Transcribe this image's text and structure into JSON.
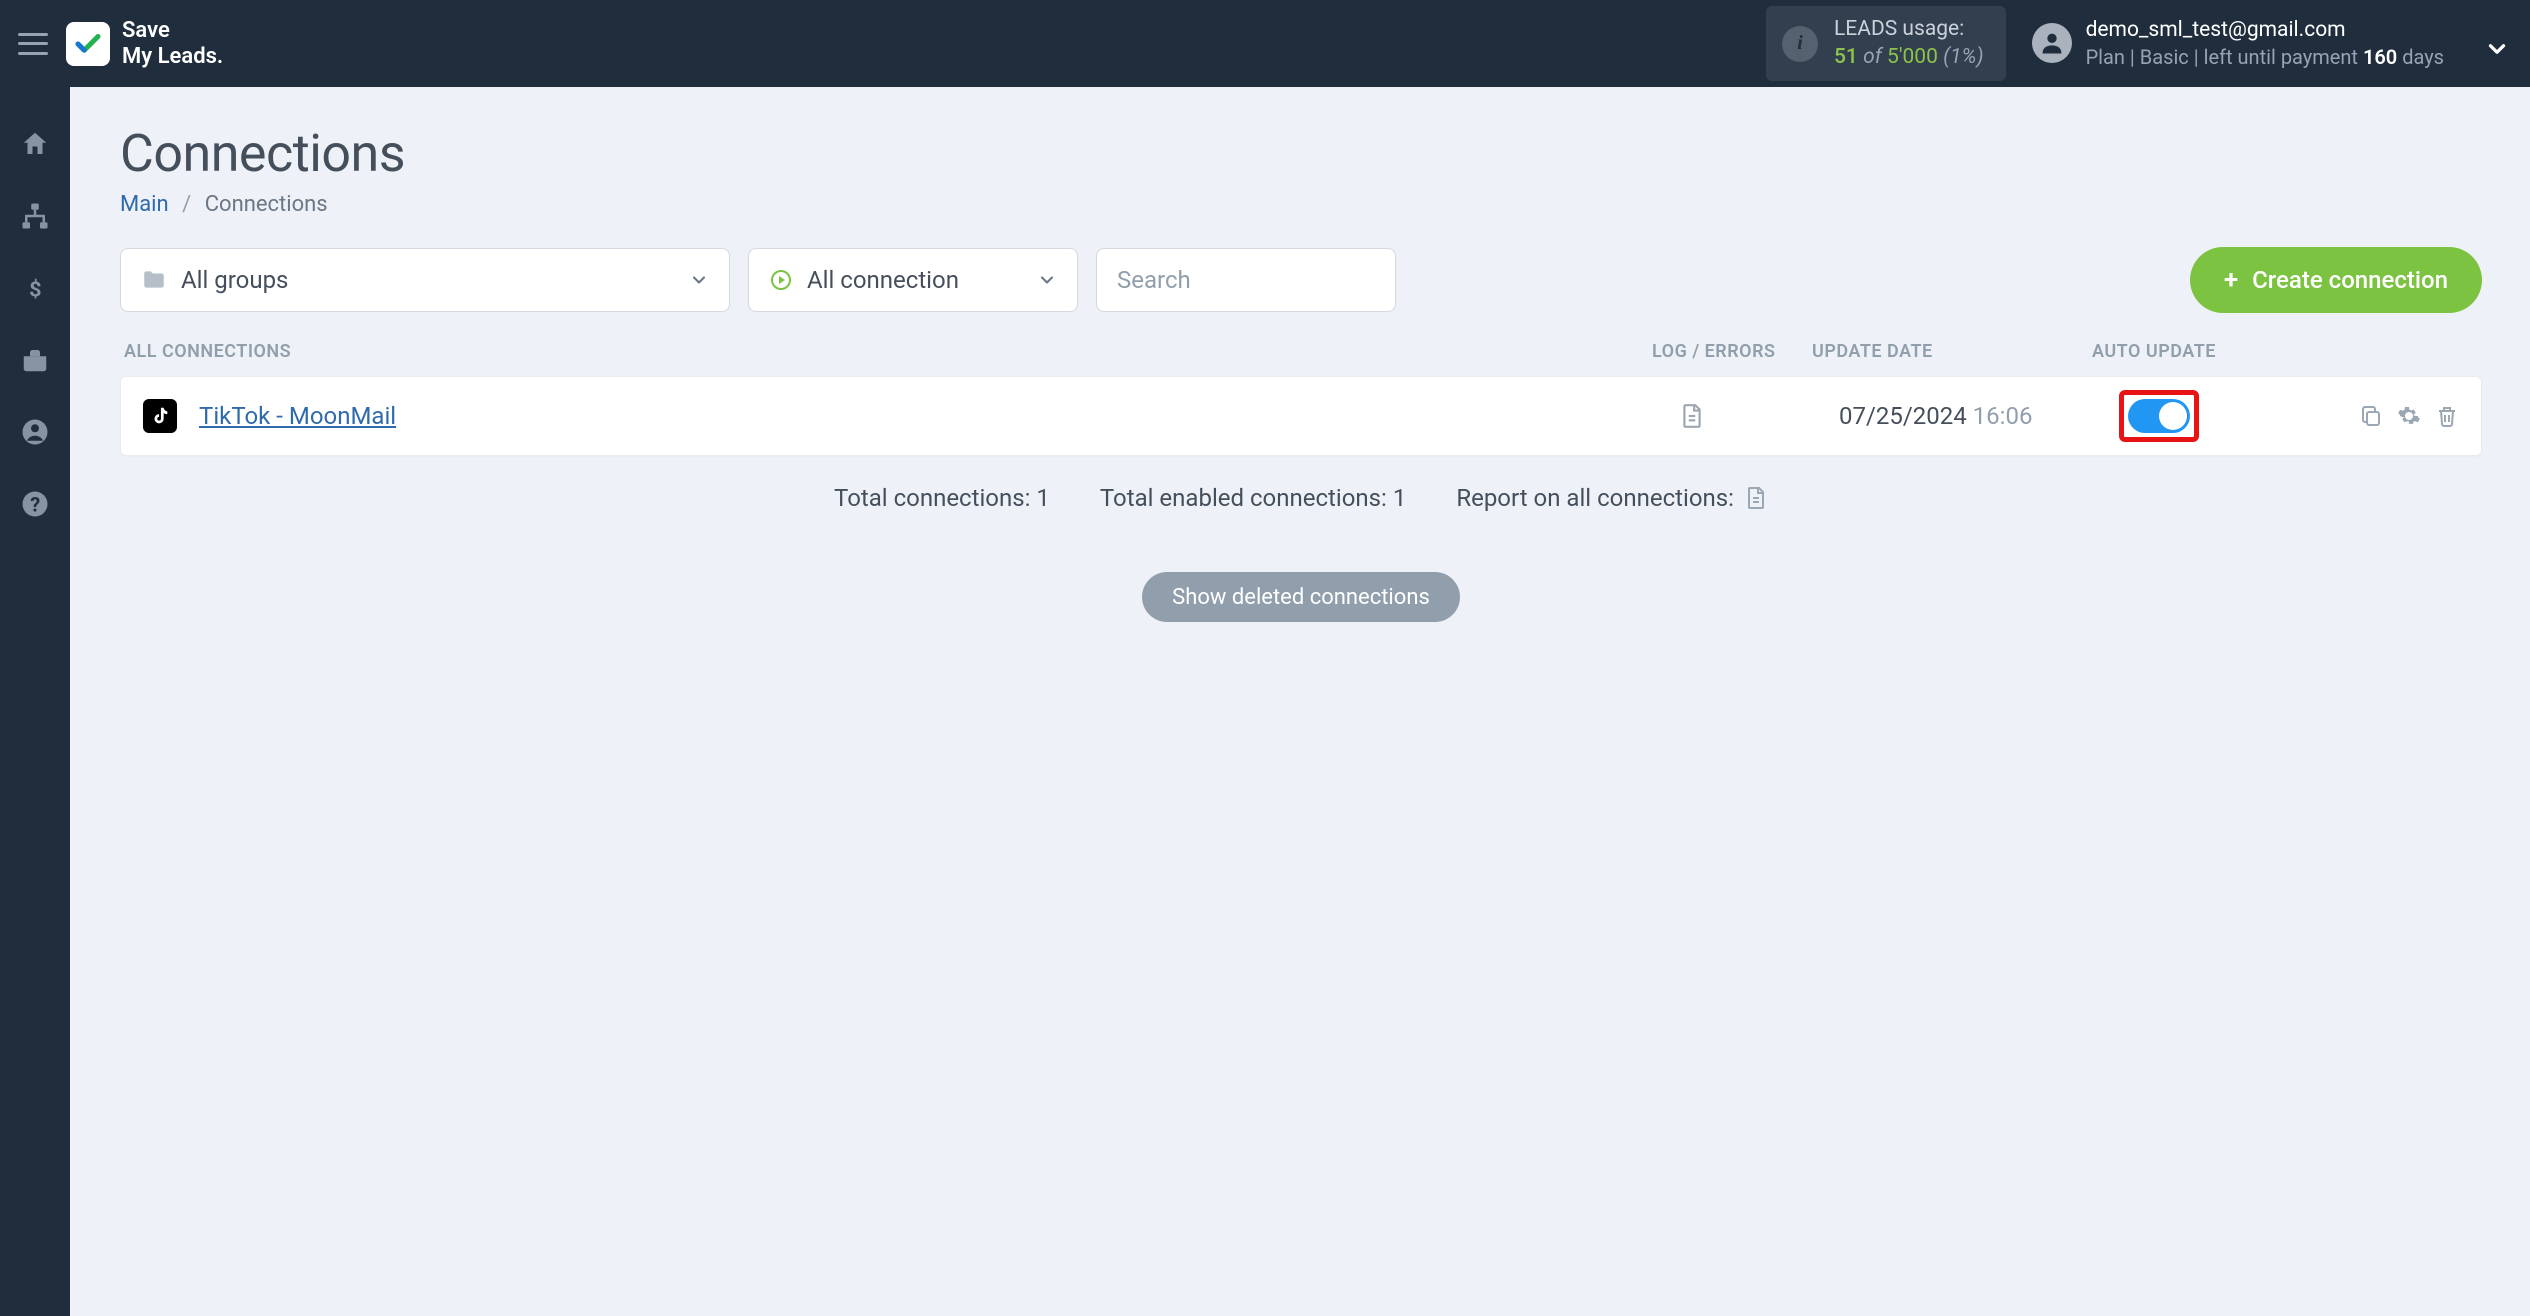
{
  "brand": {
    "line1": "Save",
    "line2": "My Leads."
  },
  "leads_usage": {
    "label": "LEADS usage:",
    "used": "51",
    "of": "of",
    "limit": "5'000",
    "percent": "(1%)"
  },
  "user": {
    "email": "demo_sml_test@gmail.com",
    "plan_prefix": "Plan |",
    "plan_name": "Basic",
    "plan_mid": "| left until payment",
    "days_left": "160",
    "days_word": "days"
  },
  "page": {
    "title": "Connections",
    "breadcrumb_home": "Main",
    "breadcrumb_current": "Connections"
  },
  "filters": {
    "groups_label": "All groups",
    "status_label": "All connection",
    "search_placeholder": "Search"
  },
  "create_button": "Create connection",
  "columns": {
    "name": "ALL CONNECTIONS",
    "log": "LOG / ERRORS",
    "date": "UPDATE DATE",
    "auto": "AUTO UPDATE"
  },
  "rows": [
    {
      "name": "TikTok - MoonMail",
      "date": "07/25/2024",
      "time": "16:06",
      "auto_update": true
    }
  ],
  "summary": {
    "total": "Total connections: 1",
    "enabled": "Total enabled connections: 1",
    "report": "Report on all connections:"
  },
  "show_deleted": "Show deleted connections"
}
